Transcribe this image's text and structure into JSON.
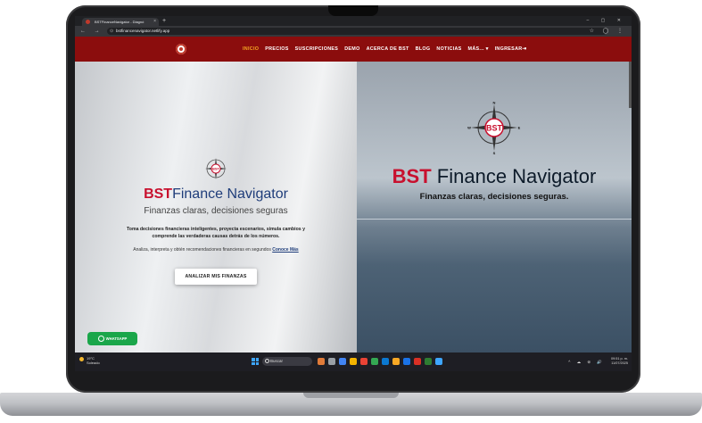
{
  "browser": {
    "tab_title": "BSTFinanceNavigator - Diagnó",
    "tab_close": "×",
    "new_tab": "+",
    "window_controls": "–  ▢  ✕",
    "nav_buttons": "←  →  ↻",
    "url": "bstfinancenavigator.netlify.app",
    "addr_right": "☆ ◯ ⋮"
  },
  "site_nav": {
    "items": [
      "INICIO",
      "PRECIOS",
      "SUSCRIPCIONES",
      "DEMO",
      "ACERCA DE BST",
      "BLOG",
      "NOTICIAS",
      "MÁS... ▾",
      "INGRESAR⇥"
    ],
    "active_index": 0
  },
  "hero_left": {
    "compass_label": "BST",
    "brand_bst": "BST",
    "brand_rest": "Finance Navigator",
    "slogan": "Finanzas claras, decisiones seguras",
    "description": "Toma decisiones financieras inteligentes, proyecta escenarios, simula cambios y comprende las verdaderas causas detrás de los números.",
    "sub_text": "Analiza, interpreta y obtén recomendaciones financieras en segundos",
    "link_text": "Conoce Más",
    "analyze_button": "ANALIZAR MIS FINANZAS",
    "whatsapp_button": "WHATSAPP"
  },
  "hero_right": {
    "compass_label": "BST",
    "compass_n": "N",
    "compass_s": "S",
    "compass_e": "E",
    "compass_w": "W",
    "brand_bst": "BST",
    "brand_rest": " Finance Navigator",
    "slogan": "Finanzas claras, decisiones seguras."
  },
  "taskbar": {
    "weather_temp": "19°C",
    "weather_desc": "Soleado",
    "search_placeholder": "Buscar",
    "tray": "^ ☁ ⊜ 🔊",
    "clock_time": "09:51 p. m.",
    "clock_date": "11/07/2025"
  },
  "colors": {
    "nav_red": "#8b0d0d",
    "active_orange": "#f5a623",
    "brand_red": "#c8102e",
    "brand_blue": "#1f3d7a",
    "whatsapp_green": "#1aa64a"
  }
}
